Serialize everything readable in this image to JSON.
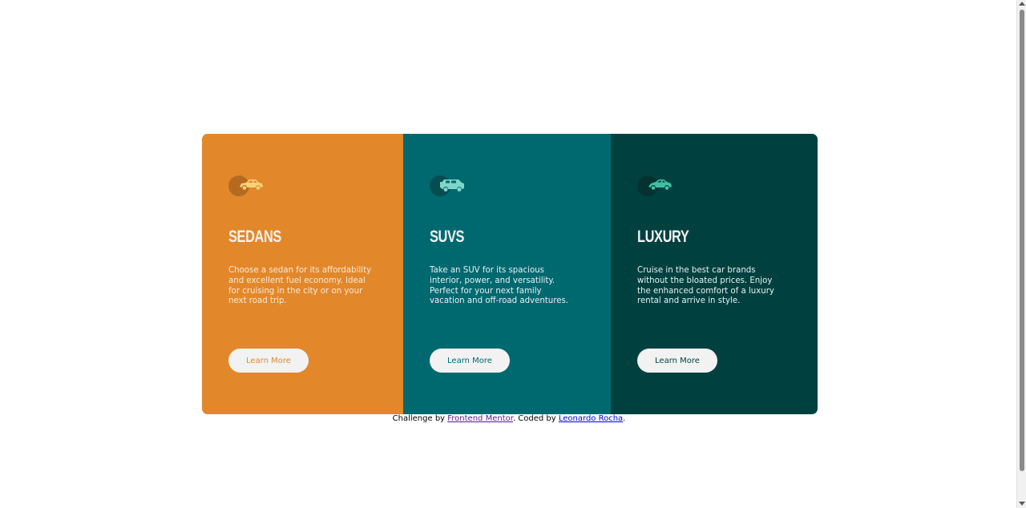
{
  "cards": [
    {
      "icon": "sedan-car-icon",
      "title": "SEDANS",
      "description": "Choose a sedan for its affordability and excellent fuel economy. Ideal for cruising in the city or on your next road trip.",
      "button_label": "Learn More",
      "bg_color": "#e2882b"
    },
    {
      "icon": "suv-car-icon",
      "title": "SUVS",
      "description": "Take an SUV for its spacious interior, power, and versatility. Perfect for your next family vacation and off-road adventures.",
      "button_label": "Learn More",
      "bg_color": "#006970"
    },
    {
      "icon": "luxury-car-icon",
      "title": "LUXURY",
      "description": "Cruise in the best car brands without the bloated prices. Enjoy the enhanced comfort of a luxury rental and arrive in style.",
      "button_label": "Learn More",
      "bg_color": "#004140"
    }
  ],
  "attribution": {
    "prefix": "Challenge by ",
    "link1": "Frontend Mentor",
    "middle": ". Coded by ",
    "link2": "Leonardo Rocha",
    "suffix": "."
  }
}
